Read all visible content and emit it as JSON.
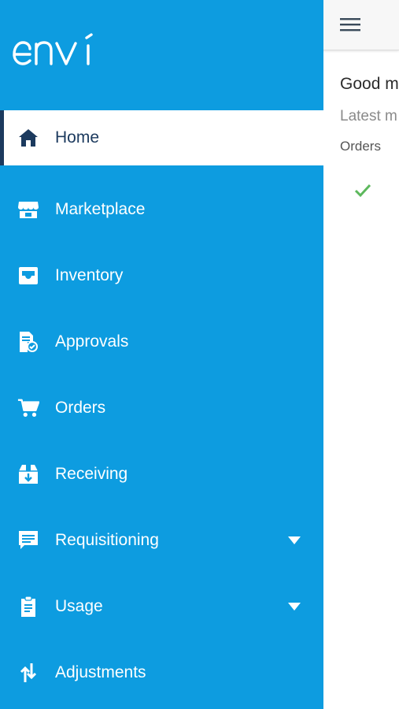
{
  "brand": {
    "logo_text": "envi"
  },
  "content": {
    "greeting": "Good m",
    "latest": "Latest m",
    "orders_label": "Orders"
  },
  "colors": {
    "drawer": "#0d9ce0",
    "active_text": "#1c3a5e",
    "check": "#5cb85c"
  },
  "nav": {
    "items": [
      {
        "label": "Home",
        "icon": "home-icon",
        "active": true
      },
      {
        "label": "Marketplace",
        "icon": "store-icon"
      },
      {
        "label": "Inventory",
        "icon": "inbox-icon"
      },
      {
        "label": "Approvals",
        "icon": "approval-document-icon"
      },
      {
        "label": "Orders",
        "icon": "cart-icon"
      },
      {
        "label": "Receiving",
        "icon": "box-receive-icon"
      },
      {
        "label": "Requisitioning",
        "icon": "chat-bubble-icon",
        "expandable": true
      },
      {
        "label": "Usage",
        "icon": "clipboard-icon",
        "expandable": true
      },
      {
        "label": "Adjustments",
        "icon": "swap-vertical-icon"
      }
    ]
  }
}
